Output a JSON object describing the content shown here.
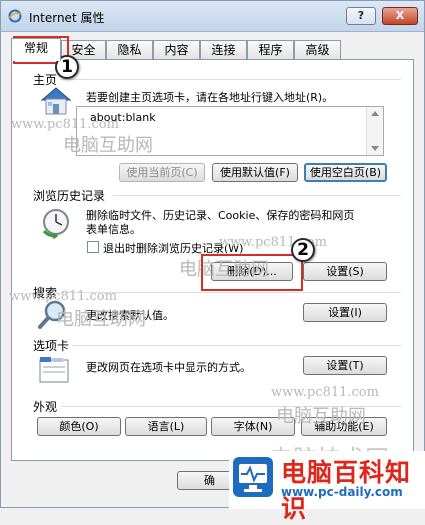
{
  "window": {
    "title": "Internet 属性",
    "help_label": "?",
    "close_label": "X"
  },
  "tabs": [
    {
      "label": "常规"
    },
    {
      "label": "安全"
    },
    {
      "label": "隐私"
    },
    {
      "label": "内容"
    },
    {
      "label": "连接"
    },
    {
      "label": "程序"
    },
    {
      "label": "高级"
    }
  ],
  "homepage": {
    "group_label": "主页",
    "description": "若要创建主页选项卡，请在各地址行键入地址(R)。",
    "url_value": "about:blank",
    "btn_use_current": "使用当前页(C)",
    "btn_use_default": "使用默认值(F)",
    "btn_use_blank": "使用空白页(B)"
  },
  "history": {
    "group_label": "浏览历史记录",
    "description_line1": "删除临时文件、历史记录、Cookie、保存的密码和网页",
    "description_line2": "表单信息。",
    "checkbox_label": "退出时删除浏览历史记录(W)",
    "btn_delete": "删除(D)...",
    "btn_settings": "设置(S)"
  },
  "search": {
    "group_label": "搜索",
    "description": "更改搜索默认值。",
    "btn_settings": "设置(I)"
  },
  "tabs_section": {
    "group_label": "选项卡",
    "description": "更改网页在选项卡中显示的方式。",
    "btn_settings": "设置(T)"
  },
  "appearance": {
    "group_label": "外观",
    "btn_colors": "颜色(O)",
    "btn_languages": "语言(L)",
    "btn_fonts": "字体(N)",
    "btn_accessibility": "辅助功能(E)"
  },
  "footer": {
    "btn_ok_partial": "确"
  },
  "annotations": {
    "step1": "1",
    "step2": "2"
  },
  "watermarks": {
    "cn_1": "电脑互助网",
    "url_1": "www.pc811.com",
    "cn_2": "电脑互助网",
    "url_2": "www.pc811.com",
    "cn_3": "电脑互助网",
    "url_3": "www.pc811.com",
    "cn_4": "电脑互助网",
    "cn_5": "电脑技术网"
  },
  "logo": {
    "title": "电脑百科知识",
    "url": "www.pc-daily.com"
  },
  "colors": {
    "highlight_red": "#d0302a",
    "logo_red": "#e0261a",
    "logo_blue": "#1d6cc0",
    "close_red": "#c0452c"
  },
  "icons": [
    "ie-icon",
    "house-icon",
    "history-clock-icon",
    "magnifier-icon",
    "tabs-window-icon",
    "pc-daily-logo-icon"
  ]
}
